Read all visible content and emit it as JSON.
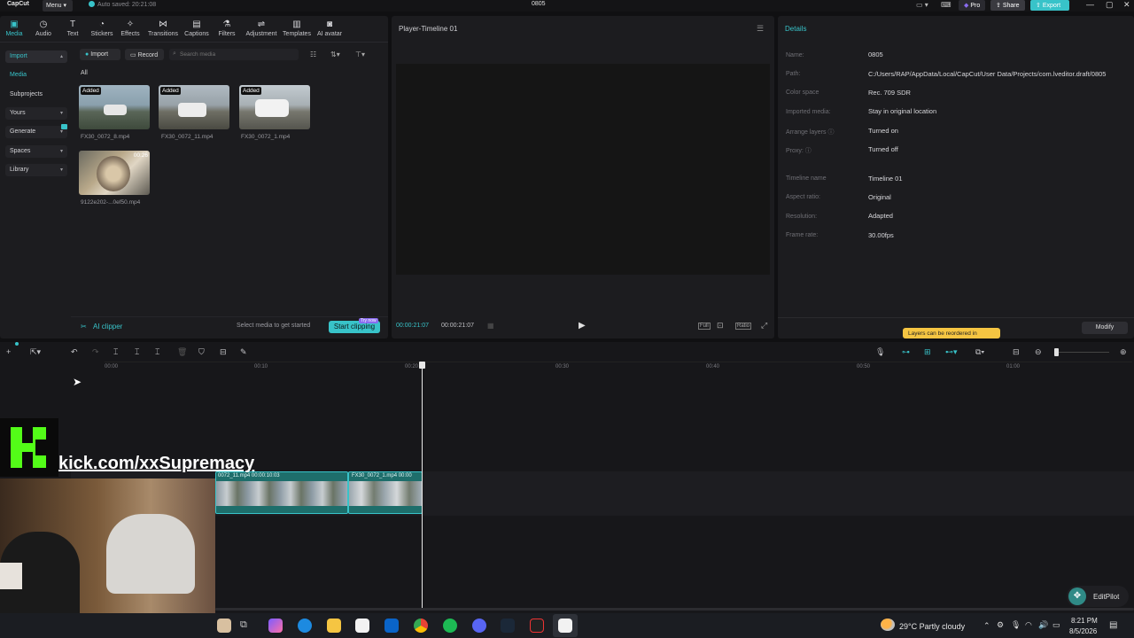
{
  "titlebar": {
    "app_name": "CapCut",
    "menu_label": "Menu",
    "autosave": "Auto saved: 20:21:08",
    "project_title": "0805",
    "pro_label": "Pro",
    "share_label": "Share",
    "export_label": "Export"
  },
  "toolbar": {
    "tabs": [
      {
        "label": "Media",
        "icon": "media-icon"
      },
      {
        "label": "Audio",
        "icon": "audio-icon"
      },
      {
        "label": "Text",
        "icon": "text-icon"
      },
      {
        "label": "Stickers",
        "icon": "stickers-icon"
      },
      {
        "label": "Effects",
        "icon": "effects-icon"
      },
      {
        "label": "Transitions",
        "icon": "transitions-icon"
      },
      {
        "label": "Captions",
        "icon": "captions-icon"
      },
      {
        "label": "Filters",
        "icon": "filters-icon"
      },
      {
        "label": "Adjustment",
        "icon": "adjustment-icon"
      },
      {
        "label": "Templates",
        "icon": "templates-icon"
      },
      {
        "label": "AI avatar",
        "icon": "ai-avatar-icon"
      }
    ]
  },
  "sidebar": {
    "items": [
      {
        "label": "Import"
      },
      {
        "label": "Media"
      },
      {
        "label": "Subprojects"
      },
      {
        "label": "Yours"
      },
      {
        "label": "Generate"
      },
      {
        "label": "Spaces"
      },
      {
        "label": "Library"
      }
    ]
  },
  "media": {
    "import_label": "Import",
    "record_label": "Record",
    "search_placeholder": "Search media",
    "filter_all": "All",
    "items": [
      {
        "name": "FX30_0072_8.mp4",
        "badge": "Added"
      },
      {
        "name": "FX30_0072_11.mp4",
        "badge": "Added"
      },
      {
        "name": "FX30_0072_1.mp4",
        "badge": "Added"
      },
      {
        "name": "9122e202-...0ef50.mp4",
        "duration": "00:26"
      }
    ],
    "ai_clipper": "AI clipper",
    "select_hint": "Select media to get started",
    "start_clipping": "Start clipping",
    "try_badge": "Try now"
  },
  "player": {
    "title": "Player-Timeline 01",
    "current_time": "00:00:21:07",
    "total_time": "00:00:21:07",
    "full_label": "Full",
    "ratio_label": "Ratio"
  },
  "details": {
    "title": "Details",
    "rows": [
      {
        "label": "Name:",
        "value": "0805"
      },
      {
        "label": "Path:",
        "value": "C:/Users/RAP/AppData/Local/CapCut/User Data/Projects/com.lveditor.draft/0805"
      },
      {
        "label": "Color space",
        "value": "Rec. 709 SDR"
      },
      {
        "label": "Imported media:",
        "value": "Stay in original location"
      },
      {
        "label": "Arrange layers",
        "value": "Turned on"
      },
      {
        "label": "Proxy:",
        "value": "Turned off"
      },
      {
        "label": "Timeline name",
        "value": "Timeline 01"
      },
      {
        "label": "Aspect ratio:",
        "value": "Original"
      },
      {
        "label": "Resolution:",
        "value": "Adapted"
      },
      {
        "label": "Frame rate:",
        "value": "30.00fps"
      }
    ],
    "tooltip": "Layers can be reordered in",
    "modify_label": "Modify"
  },
  "timeline": {
    "ruler": [
      "00:00",
      "00:10",
      "00:20",
      "00:30",
      "00:40",
      "00:50",
      "01:00"
    ],
    "clip_a_label": "0072_11.mp4  00:00:10:03",
    "clip_b_label": "FX30_0072_1.mp4  00:00"
  },
  "overlay": {
    "kick_url": "kick.com/xxSupremacy",
    "editpilot": "EditPilot"
  },
  "taskbar": {
    "weather": "29°C  Partly cloudy",
    "time": "8:21 PM",
    "date": "8/5/2026"
  },
  "colors": {
    "accent": "#38c3c9",
    "pro": "#8a6cf0"
  }
}
